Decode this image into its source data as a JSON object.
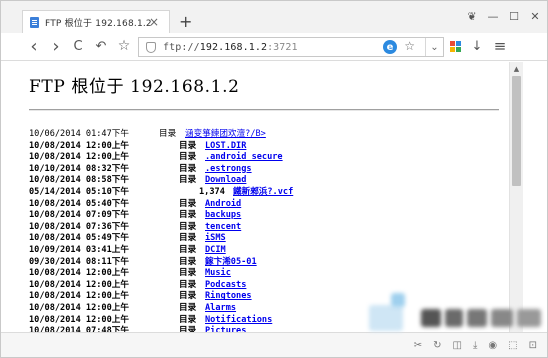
{
  "tab": {
    "title": "FTP 根位于 192.168.1.2",
    "close": "×",
    "new_tab": "+"
  },
  "window_controls": {
    "pin": "❦",
    "minimize": "—",
    "maximize": "☐",
    "close": "✕"
  },
  "toolbar": {
    "back": "‹",
    "forward": "›",
    "reload": "C",
    "undo": "↶",
    "bookmark": "☆",
    "url_scheme": "ftp://",
    "url_host": "192.168.1.2",
    "url_port": ":3721",
    "engine_badge": "e",
    "fav_star": "☆",
    "dropdown": "⌄",
    "download": "↓",
    "menu": "≡",
    "icon_names": [
      "chevron-left-icon",
      "chevron-right-icon",
      "reload-icon",
      "undo-icon",
      "star-icon",
      "shield-icon",
      "ie-engine-icon",
      "star-icon",
      "dropdown-icon",
      "apps-grid-icon",
      "download-icon",
      "menu-icon"
    ]
  },
  "page": {
    "heading": "FTP 根位于 192.168.1.2",
    "entries": [
      {
        "date": "10/06/2014 01:47下午",
        "type": "目录",
        "name": "涵变箏鍊团欢澶?/B>",
        "bold": false
      },
      {
        "date": "10/08/2014 12:00上午",
        "type": "目录",
        "name": "LOST.DIR",
        "bold": true
      },
      {
        "date": "10/08/2014 12:00上午",
        "type": "目录",
        "name": ".android_secure",
        "bold": true
      },
      {
        "date": "10/10/2014 08:32下午",
        "type": "目录",
        "name": ".estrongs",
        "bold": true
      },
      {
        "date": "10/08/2014 08:58下午",
        "type": "目录",
        "name": "Download",
        "bold": true
      },
      {
        "date": "05/14/2014 05:10下午",
        "type": "1,374",
        "name": "鐵新郲浜?.vcf",
        "bold": true
      },
      {
        "date": "10/08/2014 05:40下午",
        "type": "目录",
        "name": "Android",
        "bold": true
      },
      {
        "date": "10/08/2014 07:09下午",
        "type": "目录",
        "name": "backups",
        "bold": true
      },
      {
        "date": "10/08/2014 07:36下午",
        "type": "目录",
        "name": "tencent",
        "bold": true
      },
      {
        "date": "10/08/2014 05:49下午",
        "type": "目录",
        "name": "iSMS",
        "bold": true
      },
      {
        "date": "10/09/2014 03:41上午",
        "type": "目录",
        "name": "DCIM",
        "bold": true
      },
      {
        "date": "09/30/2014 08:11下午",
        "type": "目录",
        "name": "鎵卞浠05-01",
        "bold": true
      },
      {
        "date": "10/08/2014 12:00上午",
        "type": "目录",
        "name": "Music",
        "bold": true
      },
      {
        "date": "10/08/2014 12:00上午",
        "type": "目录",
        "name": "Podcasts",
        "bold": true
      },
      {
        "date": "10/08/2014 12:00上午",
        "type": "目录",
        "name": "Ringtones",
        "bold": true
      },
      {
        "date": "10/08/2014 12:00上午",
        "type": "目录",
        "name": "Alarms",
        "bold": true
      },
      {
        "date": "10/08/2014 12:00上午",
        "type": "目录",
        "name": "Notifications",
        "bold": true
      },
      {
        "date": "10/08/2014 07:48下午",
        "type": "目录",
        "name": "Pictures",
        "bold": true
      }
    ]
  },
  "statusbar": {
    "icons": [
      "✂",
      "↻",
      "◫",
      "⤓",
      "◉",
      "⬚",
      "⊡"
    ]
  },
  "colors": {
    "link": "#0000ee",
    "accent": "#2c8ae0",
    "tab_icon": "#3b7fd9"
  }
}
